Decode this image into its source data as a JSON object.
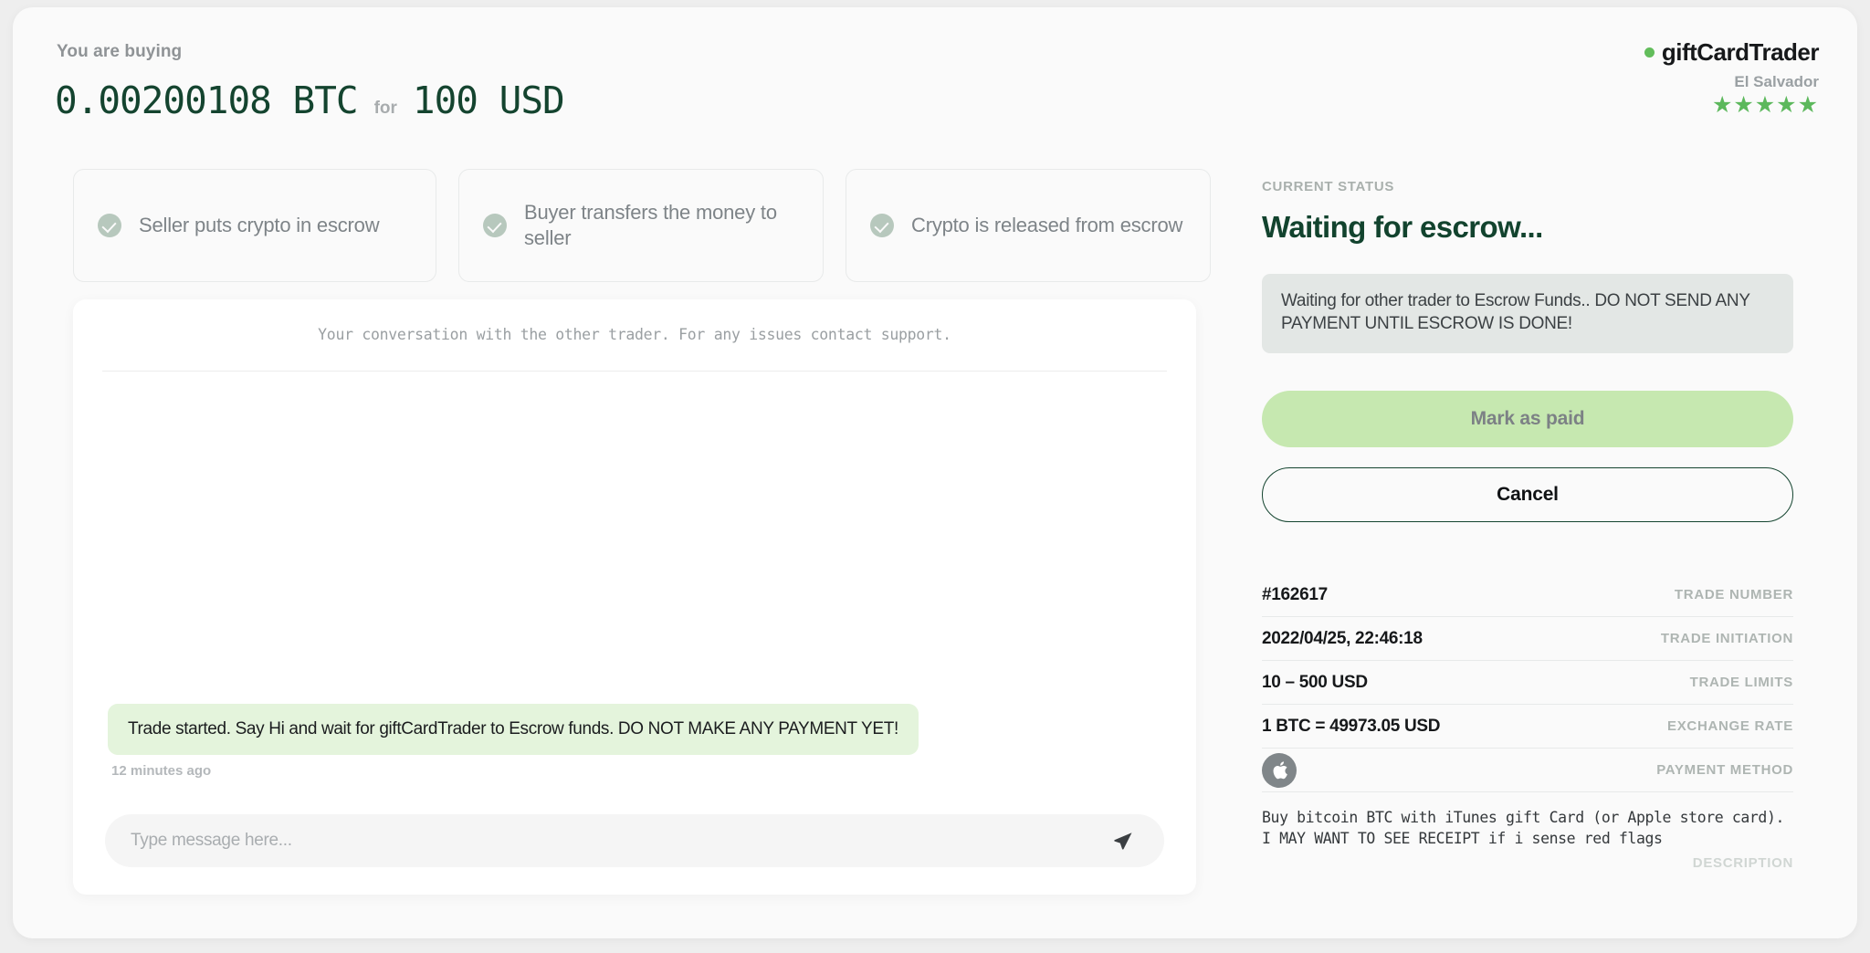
{
  "header": {
    "buying_label": "You are buying",
    "crypto_amount": "0.00200108 BTC",
    "for_label": "for",
    "fiat_amount": "100 USD"
  },
  "brand": {
    "name": "giftCardTrader",
    "country": "El Salvador",
    "stars": "★★★★★",
    "dot_color": "#62bd5b",
    "star_color": "#5cb85c"
  },
  "steps": [
    {
      "label": "Seller puts crypto in escrow"
    },
    {
      "label": "Buyer transfers the money to seller"
    },
    {
      "label": "Crypto is released from escrow"
    }
  ],
  "chat": {
    "note": "Your conversation with the other trader. For any issues contact support.",
    "messages": [
      {
        "text": "Trade started. Say Hi and wait for giftCardTrader to Escrow funds. DO NOT MAKE ANY PAYMENT YET!",
        "time": "12 minutes ago"
      }
    ],
    "input_value": "",
    "input_placeholder": "Type message here..."
  },
  "status": {
    "eyebrow": "CURRENT STATUS",
    "title": "Waiting for escrow...",
    "notice": "Waiting for other trader to Escrow Funds.. DO NOT SEND ANY PAYMENT UNTIL ESCROW IS DONE!"
  },
  "actions": {
    "mark_paid": "Mark as paid",
    "cancel": "Cancel"
  },
  "details": [
    {
      "value": "#162617",
      "key": "TRADE NUMBER"
    },
    {
      "value": "2022/04/25, 22:46:18",
      "key": "TRADE INITIATION"
    },
    {
      "value": "10 – 500 USD",
      "key": "TRADE LIMITS"
    },
    {
      "value": "1 BTC = 49973.05 USD",
      "key": "EXCHANGE RATE"
    }
  ],
  "payment_method": {
    "key": "PAYMENT METHOD",
    "icon": "apple-icon"
  },
  "description": {
    "text": "Buy bitcoin BTC with iTunes gift Card (or Apple store card).\nI MAY WANT TO SEE RECEIPT if i sense red flags",
    "key": "DESCRIPTION"
  }
}
